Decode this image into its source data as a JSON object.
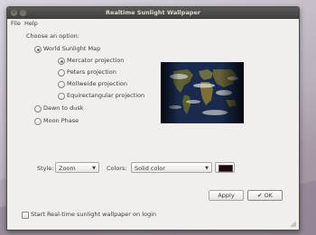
{
  "window": {
    "title": "Realtime Sunlight Wallpaper"
  },
  "menu": {
    "file": "File",
    "help": "Help"
  },
  "options": {
    "heading": "Choose an option:",
    "world_map": "World Sunlight Map",
    "projections": [
      "Mercator projection",
      "Peters projection",
      "Mollweide projection",
      "Equirectangular projection"
    ],
    "selected_projection_index": 0,
    "dawn_to_dusk": "Dawn to dusk",
    "moon_phase": "Moon Phase"
  },
  "style": {
    "label": "Style:",
    "value": "Zoom"
  },
  "colors": {
    "label": "Colors:",
    "value": "Solid color",
    "swatch": "#1a0a0c"
  },
  "buttons": {
    "apply": "Apply",
    "ok": "OK"
  },
  "login_checkbox": {
    "label": "Start Real-time sunlight wallpaper on login",
    "checked": false
  }
}
